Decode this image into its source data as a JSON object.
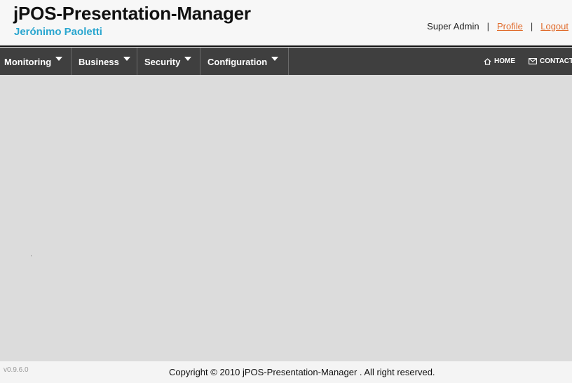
{
  "header": {
    "title": "jPOS-Presentation-Manager",
    "subtitle": "Jerónimo Paoletti",
    "user_name": "Super Admin",
    "separator": "|",
    "profile_label": "Profile",
    "logout_label": "Logout"
  },
  "nav": {
    "menus": [
      {
        "label": "Monitoring"
      },
      {
        "label": "Business"
      },
      {
        "label": "Security"
      },
      {
        "label": "Configuration"
      }
    ],
    "home_label": "HOME",
    "contact_label": "CONTACT"
  },
  "footer": {
    "version": "v0.9.6.0",
    "copyright": "Copyright © 2010 jPOS-Presentation-Manager . All right reserved."
  },
  "colors": {
    "subtitle": "#2aa6cf",
    "link": "#e06a2a",
    "navbar": "#3f3f3f",
    "content_bg": "#dcdcdc"
  }
}
